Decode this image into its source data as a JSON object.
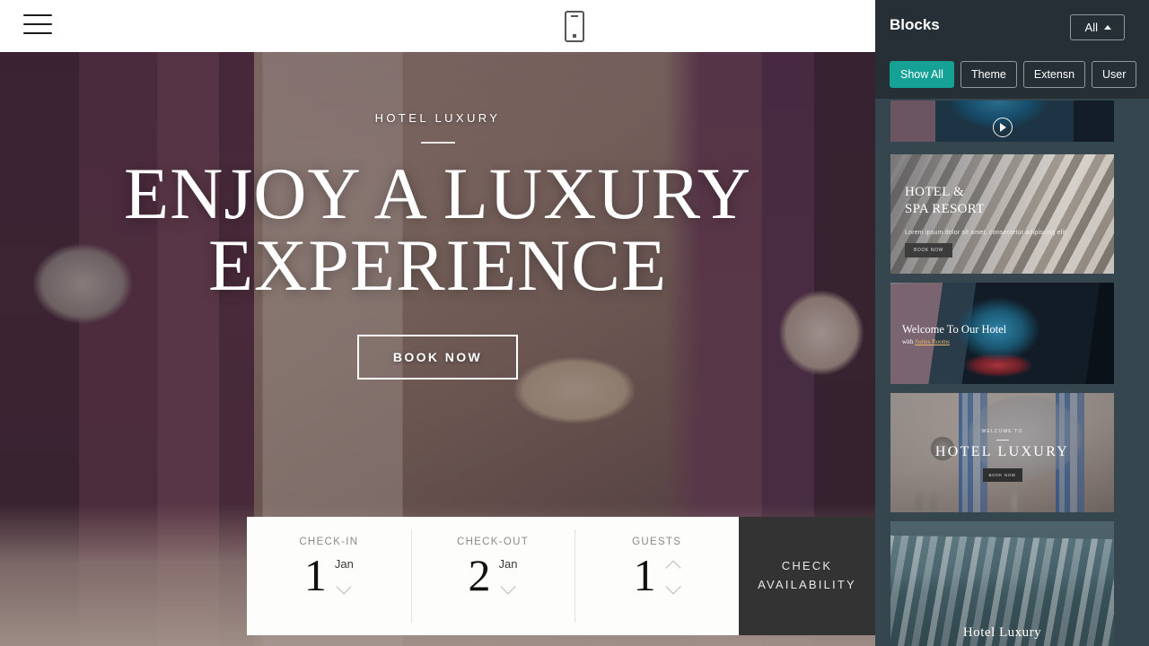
{
  "preview": {
    "topbar": {
      "menu_icon": "hamburger-icon",
      "device_icon": "mobile-preview-icon"
    },
    "hero": {
      "eyebrow": "HOTEL LUXURY",
      "title": "ENJOY A LUXURY EXPERIENCE",
      "cta_label": "BOOK NOW"
    },
    "booking": {
      "fields": [
        {
          "label": "CHECK-IN",
          "value": "1",
          "month": "Jan",
          "control": "chevron-down"
        },
        {
          "label": "CHECK-OUT",
          "value": "2",
          "month": "Jan",
          "control": "chevron-down"
        },
        {
          "label": "GUESTS",
          "value": "1",
          "month": "",
          "control": "stepper"
        }
      ],
      "submit_label": "CHECK AVAILABILITY"
    }
  },
  "panel": {
    "title": "Blocks",
    "all_dropdown": {
      "label": "All",
      "icon": "caret-up-icon"
    },
    "filters": [
      {
        "label": "Show All",
        "active": true
      },
      {
        "label": "Theme",
        "active": false
      },
      {
        "label": "Extensn",
        "active": false
      },
      {
        "label": "User",
        "active": false
      }
    ],
    "blocks": [
      {
        "name": "video-neon-hotel-block",
        "overlay_icon": "play-icon"
      },
      {
        "name": "hotel-spa-resort-block",
        "heading": "HOTEL &\nSPA RESORT",
        "paragraph": "Lorem ipsum dolor sit amet, consectetur adipiscing elit",
        "button": "BOOK NOW"
      },
      {
        "name": "welcome-to-our-hotel-block",
        "heading": "Welcome To Our Hotel",
        "subheading_prefix": "with ",
        "subheading_link": "Suites Rooms"
      },
      {
        "name": "hotel-luxury-bathroom-block",
        "eyebrow": "WELCOME TO",
        "heading": "HOTEL LUXURY",
        "button": "BOOK NOW"
      },
      {
        "name": "mountains-hotel-luxury-block",
        "heading": "Hotel Luxury"
      }
    ],
    "scrollbar": {
      "up_arrow": "scroll-up-arrow"
    },
    "close_fab": {
      "icon": "close-icon"
    }
  },
  "colors": {
    "panel_bg": "#36464e",
    "panel_header_bg": "#262f36",
    "accent_teal": "#15a196",
    "check_panel_bg": "#333333"
  }
}
